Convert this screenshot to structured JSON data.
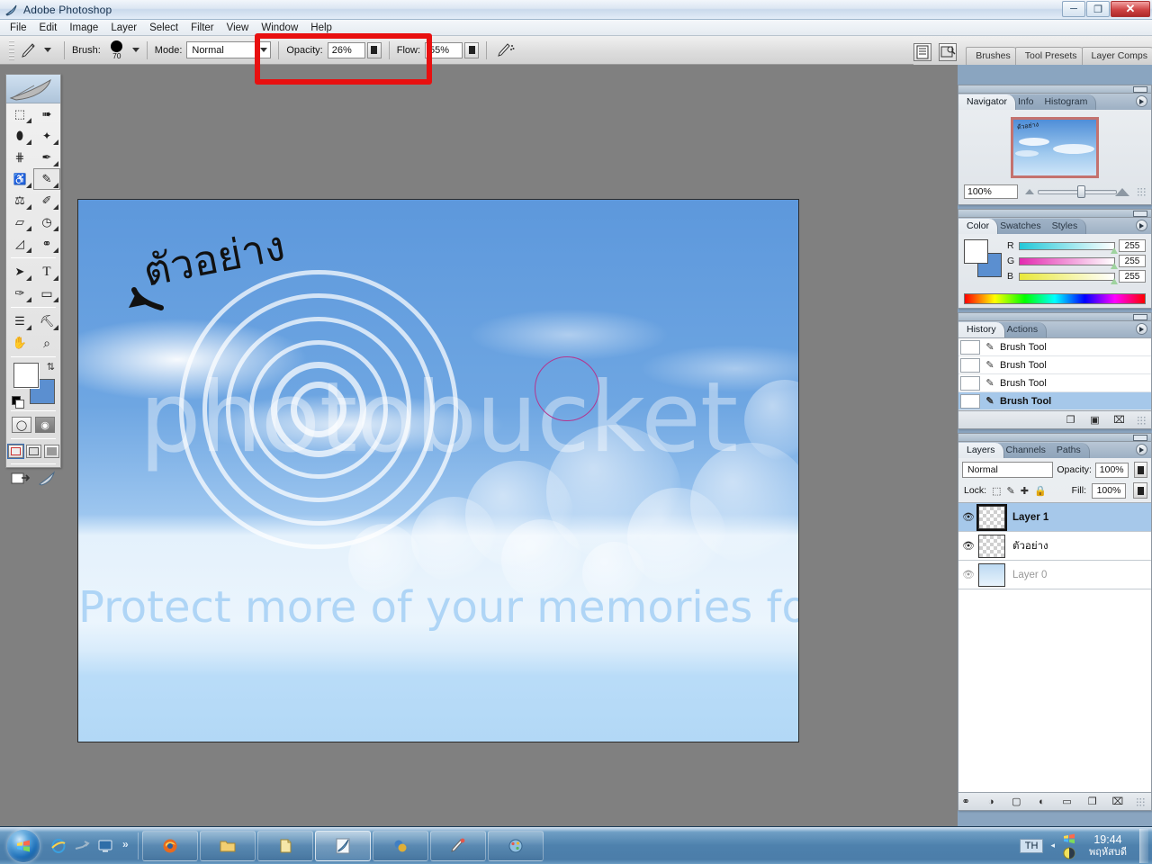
{
  "window": {
    "title": "Adobe Photoshop",
    "icon": "photoshop-feather-icon",
    "minimize_label": "–",
    "restore_label": "❐",
    "close_label": "✕"
  },
  "menubar": {
    "items": [
      {
        "label": "File"
      },
      {
        "label": "Edit"
      },
      {
        "label": "Image"
      },
      {
        "label": "Layer"
      },
      {
        "label": "Select"
      },
      {
        "label": "Filter"
      },
      {
        "label": "View"
      },
      {
        "label": "Window"
      },
      {
        "label": "Help"
      }
    ]
  },
  "options_bar": {
    "tool_icon": "brush-tool-icon",
    "brush_label": "Brush:",
    "brush_size": "70",
    "mode_label": "Mode:",
    "mode_value": "Normal",
    "opacity_label": "Opacity:",
    "opacity_value": "26%",
    "flow_label": "Flow:",
    "flow_value": "55%",
    "airbrush_icon": "airbrush-icon",
    "file_browser_icon": "file-browser-icon",
    "toggle_palettes_icon": "toggle-palettes-icon",
    "highlight_color": "#e81010"
  },
  "palette_well": {
    "tabs": [
      {
        "label": "Brushes"
      },
      {
        "label": "Tool Presets"
      },
      {
        "label": "Layer Comps"
      }
    ]
  },
  "toolbox": {
    "tools": [
      {
        "name": "marquee-tool",
        "glyph": "⬚",
        "has_flyout": true
      },
      {
        "name": "move-tool",
        "glyph": "⬈",
        "has_flyout": false
      },
      {
        "name": "lasso-tool",
        "glyph": "⬮",
        "has_flyout": true
      },
      {
        "name": "magic-wand-tool",
        "glyph": "✨",
        "has_flyout": true
      },
      {
        "name": "crop-tool",
        "glyph": "⌗",
        "has_flyout": false
      },
      {
        "name": "slice-tool",
        "glyph": "╱",
        "has_flyout": true
      },
      {
        "name": "healing-brush-tool",
        "glyph": "✒",
        "has_flyout": true
      },
      {
        "name": "brush-tool",
        "glyph": "✎",
        "has_flyout": true,
        "active": true
      },
      {
        "name": "clone-stamp-tool",
        "glyph": "⚑",
        "has_flyout": true
      },
      {
        "name": "history-brush-tool",
        "glyph": "✐",
        "has_flyout": true
      },
      {
        "name": "eraser-tool",
        "glyph": "▱",
        "has_flyout": true
      },
      {
        "name": "gradient-tool",
        "glyph": "◧",
        "has_flyout": true
      },
      {
        "name": "blur-tool",
        "glyph": "◍",
        "has_flyout": true
      },
      {
        "name": "dodge-tool",
        "glyph": "⚲",
        "has_flyout": true
      },
      {
        "name": "path-selection-tool",
        "glyph": "➤",
        "has_flyout": true
      },
      {
        "name": "type-tool",
        "glyph": "T",
        "has_flyout": true
      },
      {
        "name": "pen-tool",
        "glyph": "✑",
        "has_flyout": true
      },
      {
        "name": "rectangle-shape-tool",
        "glyph": "▭",
        "has_flyout": true
      },
      {
        "name": "notes-tool",
        "glyph": "☰",
        "has_flyout": true
      },
      {
        "name": "eyedropper-tool",
        "glyph": "⚗",
        "has_flyout": true
      },
      {
        "name": "hand-tool",
        "glyph": "✋",
        "has_flyout": false
      },
      {
        "name": "zoom-tool",
        "glyph": "⌕",
        "has_flyout": false
      }
    ],
    "foreground_color": "#ffffff",
    "background_color": "#5b8fd0",
    "swap_icon": "swap-colors-icon",
    "default_colors_icon": "default-colors-icon",
    "quickmask": [
      {
        "name": "standard-mode-button",
        "on": false
      },
      {
        "name": "quick-mask-mode-button",
        "on": true
      }
    ],
    "screen_modes": [
      {
        "name": "standard-screen-mode-button",
        "selected": true
      },
      {
        "name": "full-screen-with-menubar-button",
        "selected": false
      },
      {
        "name": "full-screen-mode-button",
        "selected": false
      }
    ],
    "jump_to": [
      {
        "name": "jump-to-imageready-button"
      },
      {
        "name": "photoshop-badge-icon"
      }
    ]
  },
  "navigator": {
    "tabs": [
      {
        "label": "Navigator",
        "active": true
      },
      {
        "label": "Info",
        "active": false
      },
      {
        "label": "Histogram",
        "active": false
      }
    ],
    "zoom_value": "100%",
    "thumbnail_note": "ตัวอย่าง",
    "view_box_color": "#c4726e"
  },
  "color_panel": {
    "tabs": [
      {
        "label": "Color",
        "active": true
      },
      {
        "label": "Swatches",
        "active": false
      },
      {
        "label": "Styles",
        "active": false
      }
    ],
    "channels": [
      {
        "label": "R",
        "value": "255"
      },
      {
        "label": "G",
        "value": "255"
      },
      {
        "label": "B",
        "value": "255"
      }
    ],
    "foreground_color": "#ffffff",
    "background_color": "#5b8fd0"
  },
  "history_panel": {
    "tabs": [
      {
        "label": "History",
        "active": true
      },
      {
        "label": "Actions",
        "active": false
      }
    ],
    "items": [
      {
        "label": "Brush Tool",
        "selected": false
      },
      {
        "label": "Brush Tool",
        "selected": false
      },
      {
        "label": "Brush Tool",
        "selected": false
      },
      {
        "label": "Brush Tool",
        "selected": true
      }
    ],
    "footer": [
      {
        "name": "new-document-from-state-button",
        "glyph": "❐"
      },
      {
        "name": "create-new-snapshot-button",
        "glyph": "▣"
      },
      {
        "name": "delete-state-button",
        "glyph": "⌧"
      }
    ]
  },
  "layers_panel": {
    "tabs": [
      {
        "label": "Layers",
        "active": true
      },
      {
        "label": "Channels",
        "active": false
      },
      {
        "label": "Paths",
        "active": false
      }
    ],
    "blend_mode": "Normal",
    "opacity_label": "Opacity:",
    "opacity_value": "100%",
    "lock_label": "Lock:",
    "lock_icons": [
      {
        "name": "lock-transparency-icon",
        "glyph": "⬚"
      },
      {
        "name": "lock-image-pixels-icon",
        "glyph": "✎"
      },
      {
        "name": "lock-position-icon",
        "glyph": "✚"
      },
      {
        "name": "lock-all-icon",
        "glyph": "ὑ2"
      }
    ],
    "fill_label": "Fill:",
    "fill_value": "100%",
    "layers": [
      {
        "name": "Layer 1",
        "visible": true,
        "selected": true,
        "transparent": true,
        "dim": false
      },
      {
        "name": "ตัวอย่าง",
        "visible": true,
        "selected": false,
        "transparent": true,
        "dim": false
      },
      {
        "name": "Layer 0",
        "visible": true,
        "selected": false,
        "transparent": false,
        "dim": true
      }
    ],
    "footer": [
      {
        "name": "link-layers-button",
        "glyph": "⚭"
      },
      {
        "name": "layer-style-button",
        "glyph": "◑"
      },
      {
        "name": "add-layer-mask-button",
        "glyph": "▢"
      },
      {
        "name": "new-adjustment-layer-button",
        "glyph": "◐"
      },
      {
        "name": "new-group-button",
        "glyph": "▭"
      },
      {
        "name": "new-layer-button",
        "glyph": "❐"
      },
      {
        "name": "delete-layer-button",
        "glyph": "⌧"
      }
    ]
  },
  "canvas": {
    "annotation_text": "ตัวอย่าง",
    "watermark_main": "photobucket",
    "watermark_tagline": "Protect more of your memories for less!",
    "brush_cursor_color": "#b3368f",
    "brush_cursor_diameter": "70"
  },
  "taskbar": {
    "start_label": "Start",
    "quick_launch": [
      {
        "name": "internet-explorer-icon"
      },
      {
        "name": "flip-3d-icon"
      },
      {
        "name": "show-desktop-icon"
      }
    ],
    "overflow_label": "»",
    "tasks": [
      {
        "name": "firefox-window-button",
        "active": false
      },
      {
        "name": "folder-window-button",
        "active": false
      },
      {
        "name": "document-window-button",
        "active": false
      },
      {
        "name": "photoshop-window-button",
        "active": true
      },
      {
        "name": "imageready-window-button",
        "active": false
      },
      {
        "name": "paint-window-button",
        "active": false
      },
      {
        "name": "media-window-button",
        "active": false
      }
    ],
    "tray": {
      "language": "TH",
      "arrow": "◂",
      "time": "19:44",
      "date": "พฤหัสบดี"
    }
  }
}
